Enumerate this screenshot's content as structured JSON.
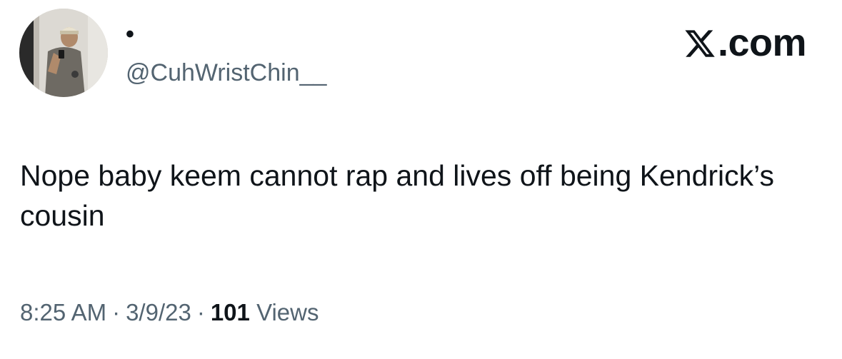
{
  "tweet": {
    "author": {
      "display_name": "•",
      "handle": "@CuhWristChin__"
    },
    "brand": {
      "suffix": ".com",
      "icon": "x-logo-icon"
    },
    "text": "Nope baby keem cannot rap and lives off being Kendrick’s cousin",
    "meta": {
      "time": "8:25 AM",
      "separator": "·",
      "date": "3/9/23",
      "views_count": "101",
      "views_label": "Views"
    }
  },
  "colors": {
    "text_primary": "#0f1419",
    "text_secondary": "#536471",
    "background": "#ffffff"
  }
}
